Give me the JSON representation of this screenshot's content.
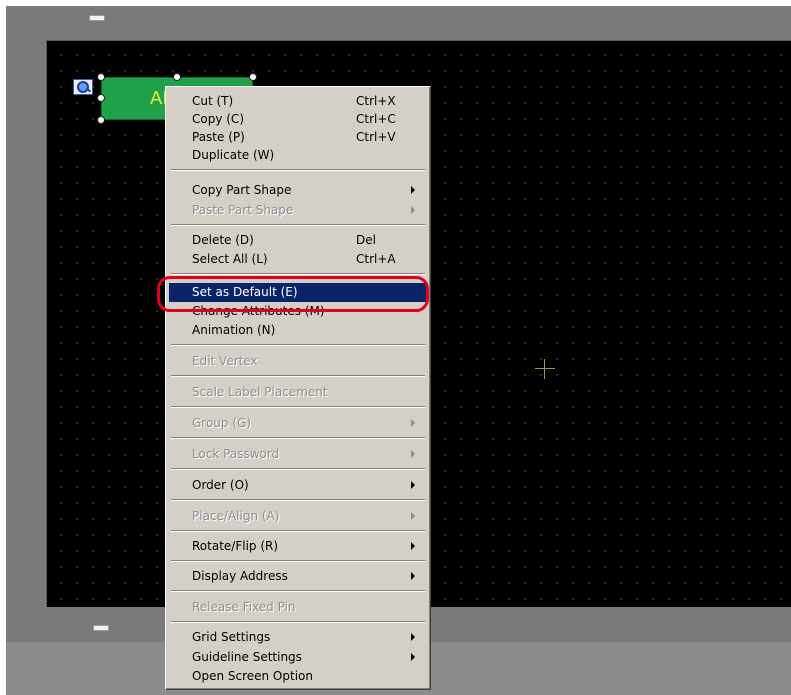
{
  "canvas": {
    "part_label": "AB"
  },
  "context_menu": {
    "items": [
      {
        "label": "Cut (T)",
        "shortcut": "Ctrl+X"
      },
      {
        "label": "Copy (C)",
        "shortcut": "Ctrl+C"
      },
      {
        "label": "Paste (P)",
        "shortcut": "Ctrl+V"
      },
      {
        "label": "Duplicate (W)",
        "shortcut": ""
      },
      {
        "label": "Copy Part Shape",
        "shortcut": "",
        "submenu": true
      },
      {
        "label": "Paste Part Shape",
        "shortcut": "",
        "submenu": true,
        "disabled": true
      },
      {
        "label": "Delete (D)",
        "shortcut": "Del"
      },
      {
        "label": "Select All (L)",
        "shortcut": "Ctrl+A"
      },
      {
        "label": "Set as Default (E)",
        "shortcut": "",
        "highlighted": true
      },
      {
        "label": "Change Attributes (M)",
        "shortcut": ""
      },
      {
        "label": "Animation (N)",
        "shortcut": ""
      },
      {
        "label": "Edit Vertex",
        "shortcut": "",
        "disabled": true
      },
      {
        "label": "Scale Label Placement",
        "shortcut": "",
        "disabled": true
      },
      {
        "label": "Group (G)",
        "shortcut": "",
        "submenu": true,
        "disabled": true
      },
      {
        "label": "Lock Password",
        "shortcut": "",
        "submenu": true,
        "disabled": true
      },
      {
        "label": "Order (O)",
        "shortcut": "",
        "submenu": true
      },
      {
        "label": "Place/Align (A)",
        "shortcut": "",
        "submenu": true,
        "disabled": true
      },
      {
        "label": "Rotate/Flip (R)",
        "shortcut": "",
        "submenu": true
      },
      {
        "label": "Display Address",
        "shortcut": "",
        "submenu": true
      },
      {
        "label": "Release Fixed Pin",
        "shortcut": "",
        "disabled": true
      },
      {
        "label": "Grid Settings",
        "shortcut": "",
        "submenu": true
      },
      {
        "label": "Guideline Settings",
        "shortcut": "",
        "submenu": true
      },
      {
        "label": "Open Screen Option",
        "shortcut": ""
      }
    ]
  },
  "colors": {
    "highlight": "#0a246a",
    "callout": "#e3001b",
    "part_fill": "#1fa14a",
    "part_text": "#e9ee3a"
  }
}
